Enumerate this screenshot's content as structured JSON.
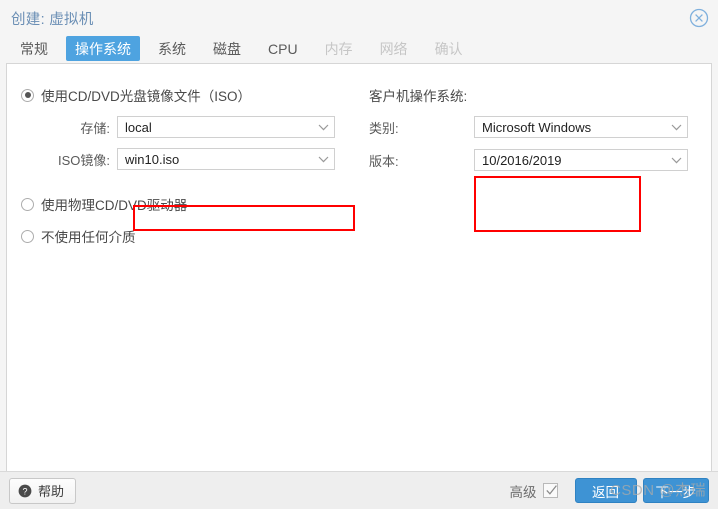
{
  "window": {
    "title": "创建: 虚拟机",
    "close_icon": "close-circle-icon"
  },
  "tabs": [
    {
      "label": "常规",
      "state": "normal"
    },
    {
      "label": "操作系统",
      "state": "active"
    },
    {
      "label": "系统",
      "state": "normal"
    },
    {
      "label": "磁盘",
      "state": "normal"
    },
    {
      "label": "CPU",
      "state": "normal"
    },
    {
      "label": "内存",
      "state": "disabled"
    },
    {
      "label": "网络",
      "state": "disabled"
    },
    {
      "label": "确认",
      "state": "disabled"
    }
  ],
  "media": {
    "options": [
      {
        "label": "使用CD/DVD光盘镜像文件（ISO）",
        "selected": true
      },
      {
        "label": "使用物理CD/DVD驱动器",
        "selected": false
      },
      {
        "label": "不使用任何介质",
        "selected": false
      }
    ],
    "fields": [
      {
        "label": "存储:",
        "value": "local",
        "highlighted": false
      },
      {
        "label": "ISO镜像:",
        "value": "win10.iso",
        "highlighted": true
      }
    ]
  },
  "guest_os": {
    "heading": "客户机操作系统:",
    "fields": [
      {
        "label": "类别:",
        "value": "Microsoft Windows"
      },
      {
        "label": "版本:",
        "value": "10/2016/2019"
      }
    ],
    "highlighted": true
  },
  "footer": {
    "help_label": "帮助",
    "help_icon": "question-circle-icon",
    "advanced_label": "高级",
    "advanced_checked": true,
    "back_button": "返回",
    "next_button": "下一步"
  },
  "watermark": "CSDN @杰瑞",
  "colors": {
    "accent": "#4ea3e0",
    "primary_button": "#3e93d4",
    "highlight": "#ff0000",
    "title_text": "#6b8fb5",
    "disabled_tab": "#c6c6c6"
  }
}
